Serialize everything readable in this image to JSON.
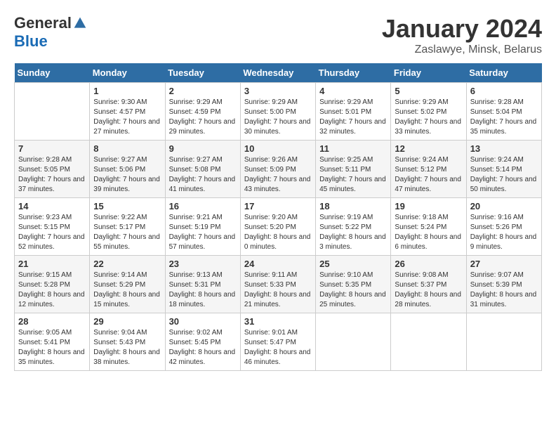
{
  "header": {
    "logo_general": "General",
    "logo_blue": "Blue",
    "month_title": "January 2024",
    "location": "Zaslawye, Minsk, Belarus"
  },
  "days_of_week": [
    "Sunday",
    "Monday",
    "Tuesday",
    "Wednesday",
    "Thursday",
    "Friday",
    "Saturday"
  ],
  "weeks": [
    [
      {
        "day": "",
        "detail": ""
      },
      {
        "day": "1",
        "detail": "Sunrise: 9:30 AM\nSunset: 4:57 PM\nDaylight: 7 hours\nand 27 minutes."
      },
      {
        "day": "2",
        "detail": "Sunrise: 9:29 AM\nSunset: 4:59 PM\nDaylight: 7 hours\nand 29 minutes."
      },
      {
        "day": "3",
        "detail": "Sunrise: 9:29 AM\nSunset: 5:00 PM\nDaylight: 7 hours\nand 30 minutes."
      },
      {
        "day": "4",
        "detail": "Sunrise: 9:29 AM\nSunset: 5:01 PM\nDaylight: 7 hours\nand 32 minutes."
      },
      {
        "day": "5",
        "detail": "Sunrise: 9:29 AM\nSunset: 5:02 PM\nDaylight: 7 hours\nand 33 minutes."
      },
      {
        "day": "6",
        "detail": "Sunrise: 9:28 AM\nSunset: 5:04 PM\nDaylight: 7 hours\nand 35 minutes."
      }
    ],
    [
      {
        "day": "7",
        "detail": "Sunrise: 9:28 AM\nSunset: 5:05 PM\nDaylight: 7 hours\nand 37 minutes."
      },
      {
        "day": "8",
        "detail": "Sunrise: 9:27 AM\nSunset: 5:06 PM\nDaylight: 7 hours\nand 39 minutes."
      },
      {
        "day": "9",
        "detail": "Sunrise: 9:27 AM\nSunset: 5:08 PM\nDaylight: 7 hours\nand 41 minutes."
      },
      {
        "day": "10",
        "detail": "Sunrise: 9:26 AM\nSunset: 5:09 PM\nDaylight: 7 hours\nand 43 minutes."
      },
      {
        "day": "11",
        "detail": "Sunrise: 9:25 AM\nSunset: 5:11 PM\nDaylight: 7 hours\nand 45 minutes."
      },
      {
        "day": "12",
        "detail": "Sunrise: 9:24 AM\nSunset: 5:12 PM\nDaylight: 7 hours\nand 47 minutes."
      },
      {
        "day": "13",
        "detail": "Sunrise: 9:24 AM\nSunset: 5:14 PM\nDaylight: 7 hours\nand 50 minutes."
      }
    ],
    [
      {
        "day": "14",
        "detail": "Sunrise: 9:23 AM\nSunset: 5:15 PM\nDaylight: 7 hours\nand 52 minutes."
      },
      {
        "day": "15",
        "detail": "Sunrise: 9:22 AM\nSunset: 5:17 PM\nDaylight: 7 hours\nand 55 minutes."
      },
      {
        "day": "16",
        "detail": "Sunrise: 9:21 AM\nSunset: 5:19 PM\nDaylight: 7 hours\nand 57 minutes."
      },
      {
        "day": "17",
        "detail": "Sunrise: 9:20 AM\nSunset: 5:20 PM\nDaylight: 8 hours\nand 0 minutes."
      },
      {
        "day": "18",
        "detail": "Sunrise: 9:19 AM\nSunset: 5:22 PM\nDaylight: 8 hours\nand 3 minutes."
      },
      {
        "day": "19",
        "detail": "Sunrise: 9:18 AM\nSunset: 5:24 PM\nDaylight: 8 hours\nand 6 minutes."
      },
      {
        "day": "20",
        "detail": "Sunrise: 9:16 AM\nSunset: 5:26 PM\nDaylight: 8 hours\nand 9 minutes."
      }
    ],
    [
      {
        "day": "21",
        "detail": "Sunrise: 9:15 AM\nSunset: 5:28 PM\nDaylight: 8 hours\nand 12 minutes."
      },
      {
        "day": "22",
        "detail": "Sunrise: 9:14 AM\nSunset: 5:29 PM\nDaylight: 8 hours\nand 15 minutes."
      },
      {
        "day": "23",
        "detail": "Sunrise: 9:13 AM\nSunset: 5:31 PM\nDaylight: 8 hours\nand 18 minutes."
      },
      {
        "day": "24",
        "detail": "Sunrise: 9:11 AM\nSunset: 5:33 PM\nDaylight: 8 hours\nand 21 minutes."
      },
      {
        "day": "25",
        "detail": "Sunrise: 9:10 AM\nSunset: 5:35 PM\nDaylight: 8 hours\nand 25 minutes."
      },
      {
        "day": "26",
        "detail": "Sunrise: 9:08 AM\nSunset: 5:37 PM\nDaylight: 8 hours\nand 28 minutes."
      },
      {
        "day": "27",
        "detail": "Sunrise: 9:07 AM\nSunset: 5:39 PM\nDaylight: 8 hours\nand 31 minutes."
      }
    ],
    [
      {
        "day": "28",
        "detail": "Sunrise: 9:05 AM\nSunset: 5:41 PM\nDaylight: 8 hours\nand 35 minutes."
      },
      {
        "day": "29",
        "detail": "Sunrise: 9:04 AM\nSunset: 5:43 PM\nDaylight: 8 hours\nand 38 minutes."
      },
      {
        "day": "30",
        "detail": "Sunrise: 9:02 AM\nSunset: 5:45 PM\nDaylight: 8 hours\nand 42 minutes."
      },
      {
        "day": "31",
        "detail": "Sunrise: 9:01 AM\nSunset: 5:47 PM\nDaylight: 8 hours\nand 46 minutes."
      },
      {
        "day": "",
        "detail": ""
      },
      {
        "day": "",
        "detail": ""
      },
      {
        "day": "",
        "detail": ""
      }
    ]
  ]
}
